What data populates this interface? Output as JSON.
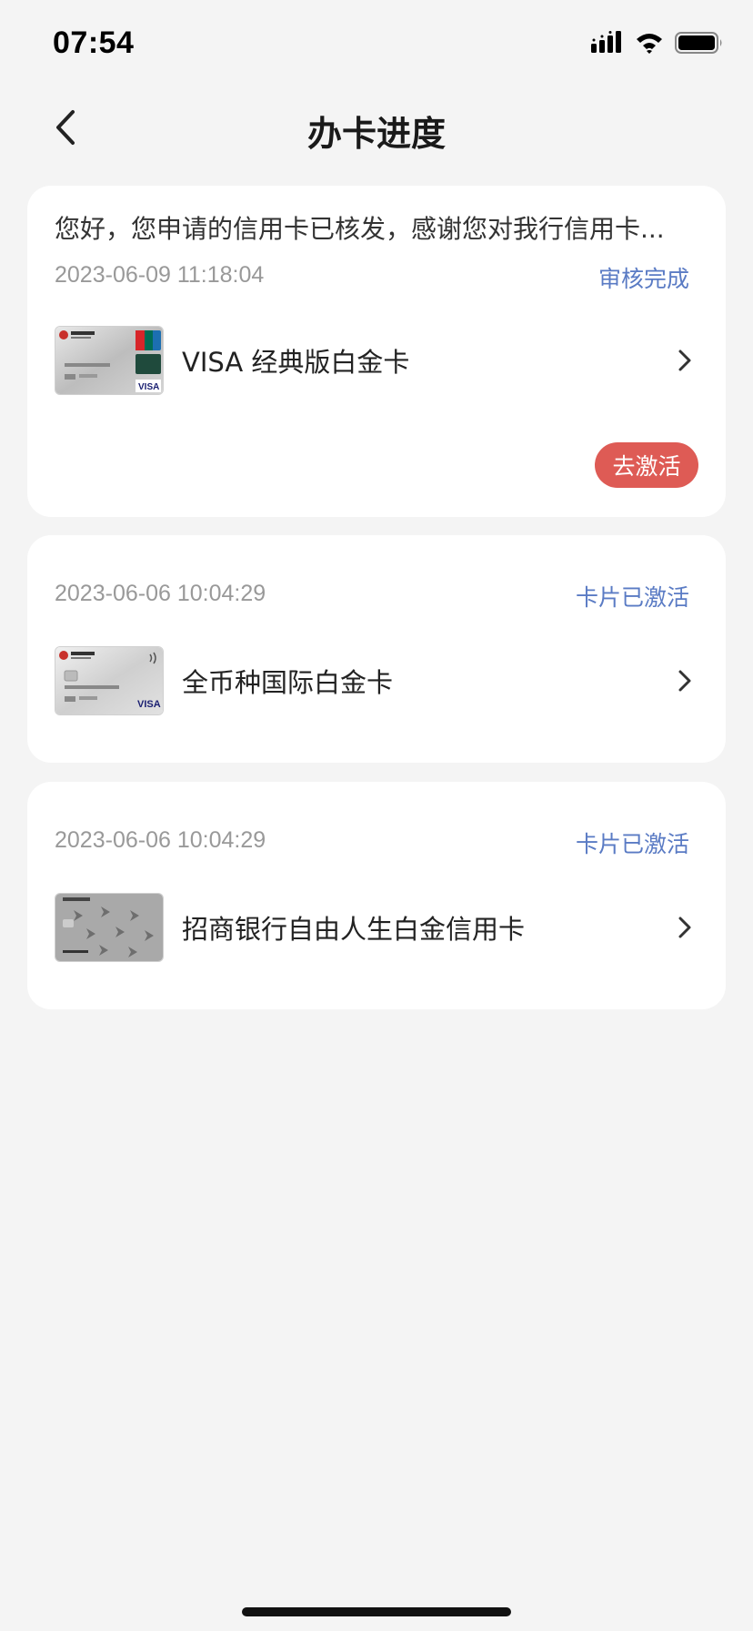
{
  "status_bar": {
    "time": "07:54"
  },
  "nav": {
    "title": "办卡进度"
  },
  "applications": [
    {
      "message": "您好，您申请的信用卡已核发，感谢您对我行信用卡...",
      "date": "2023-06-09 11:18:04",
      "status": "审核完成",
      "card_name": "VISA 经典版白金卡",
      "action_label": "去激活"
    },
    {
      "date": "2023-06-06 10:04:29",
      "status": "卡片已激活",
      "card_name": "全币种国际白金卡"
    },
    {
      "date": "2023-06-06 10:04:29",
      "status": "卡片已激活",
      "card_name": "招商银行自由人生白金信用卡"
    }
  ],
  "icons": {
    "back": "chevron-left-icon",
    "row_arrow": "chevron-right-icon",
    "signal": "signal-icon",
    "wifi": "wifi-icon",
    "battery": "battery-icon"
  },
  "colors": {
    "status_text": "#5a7bc4",
    "activate_button": "#de5b55",
    "background": "#f4f4f4"
  }
}
